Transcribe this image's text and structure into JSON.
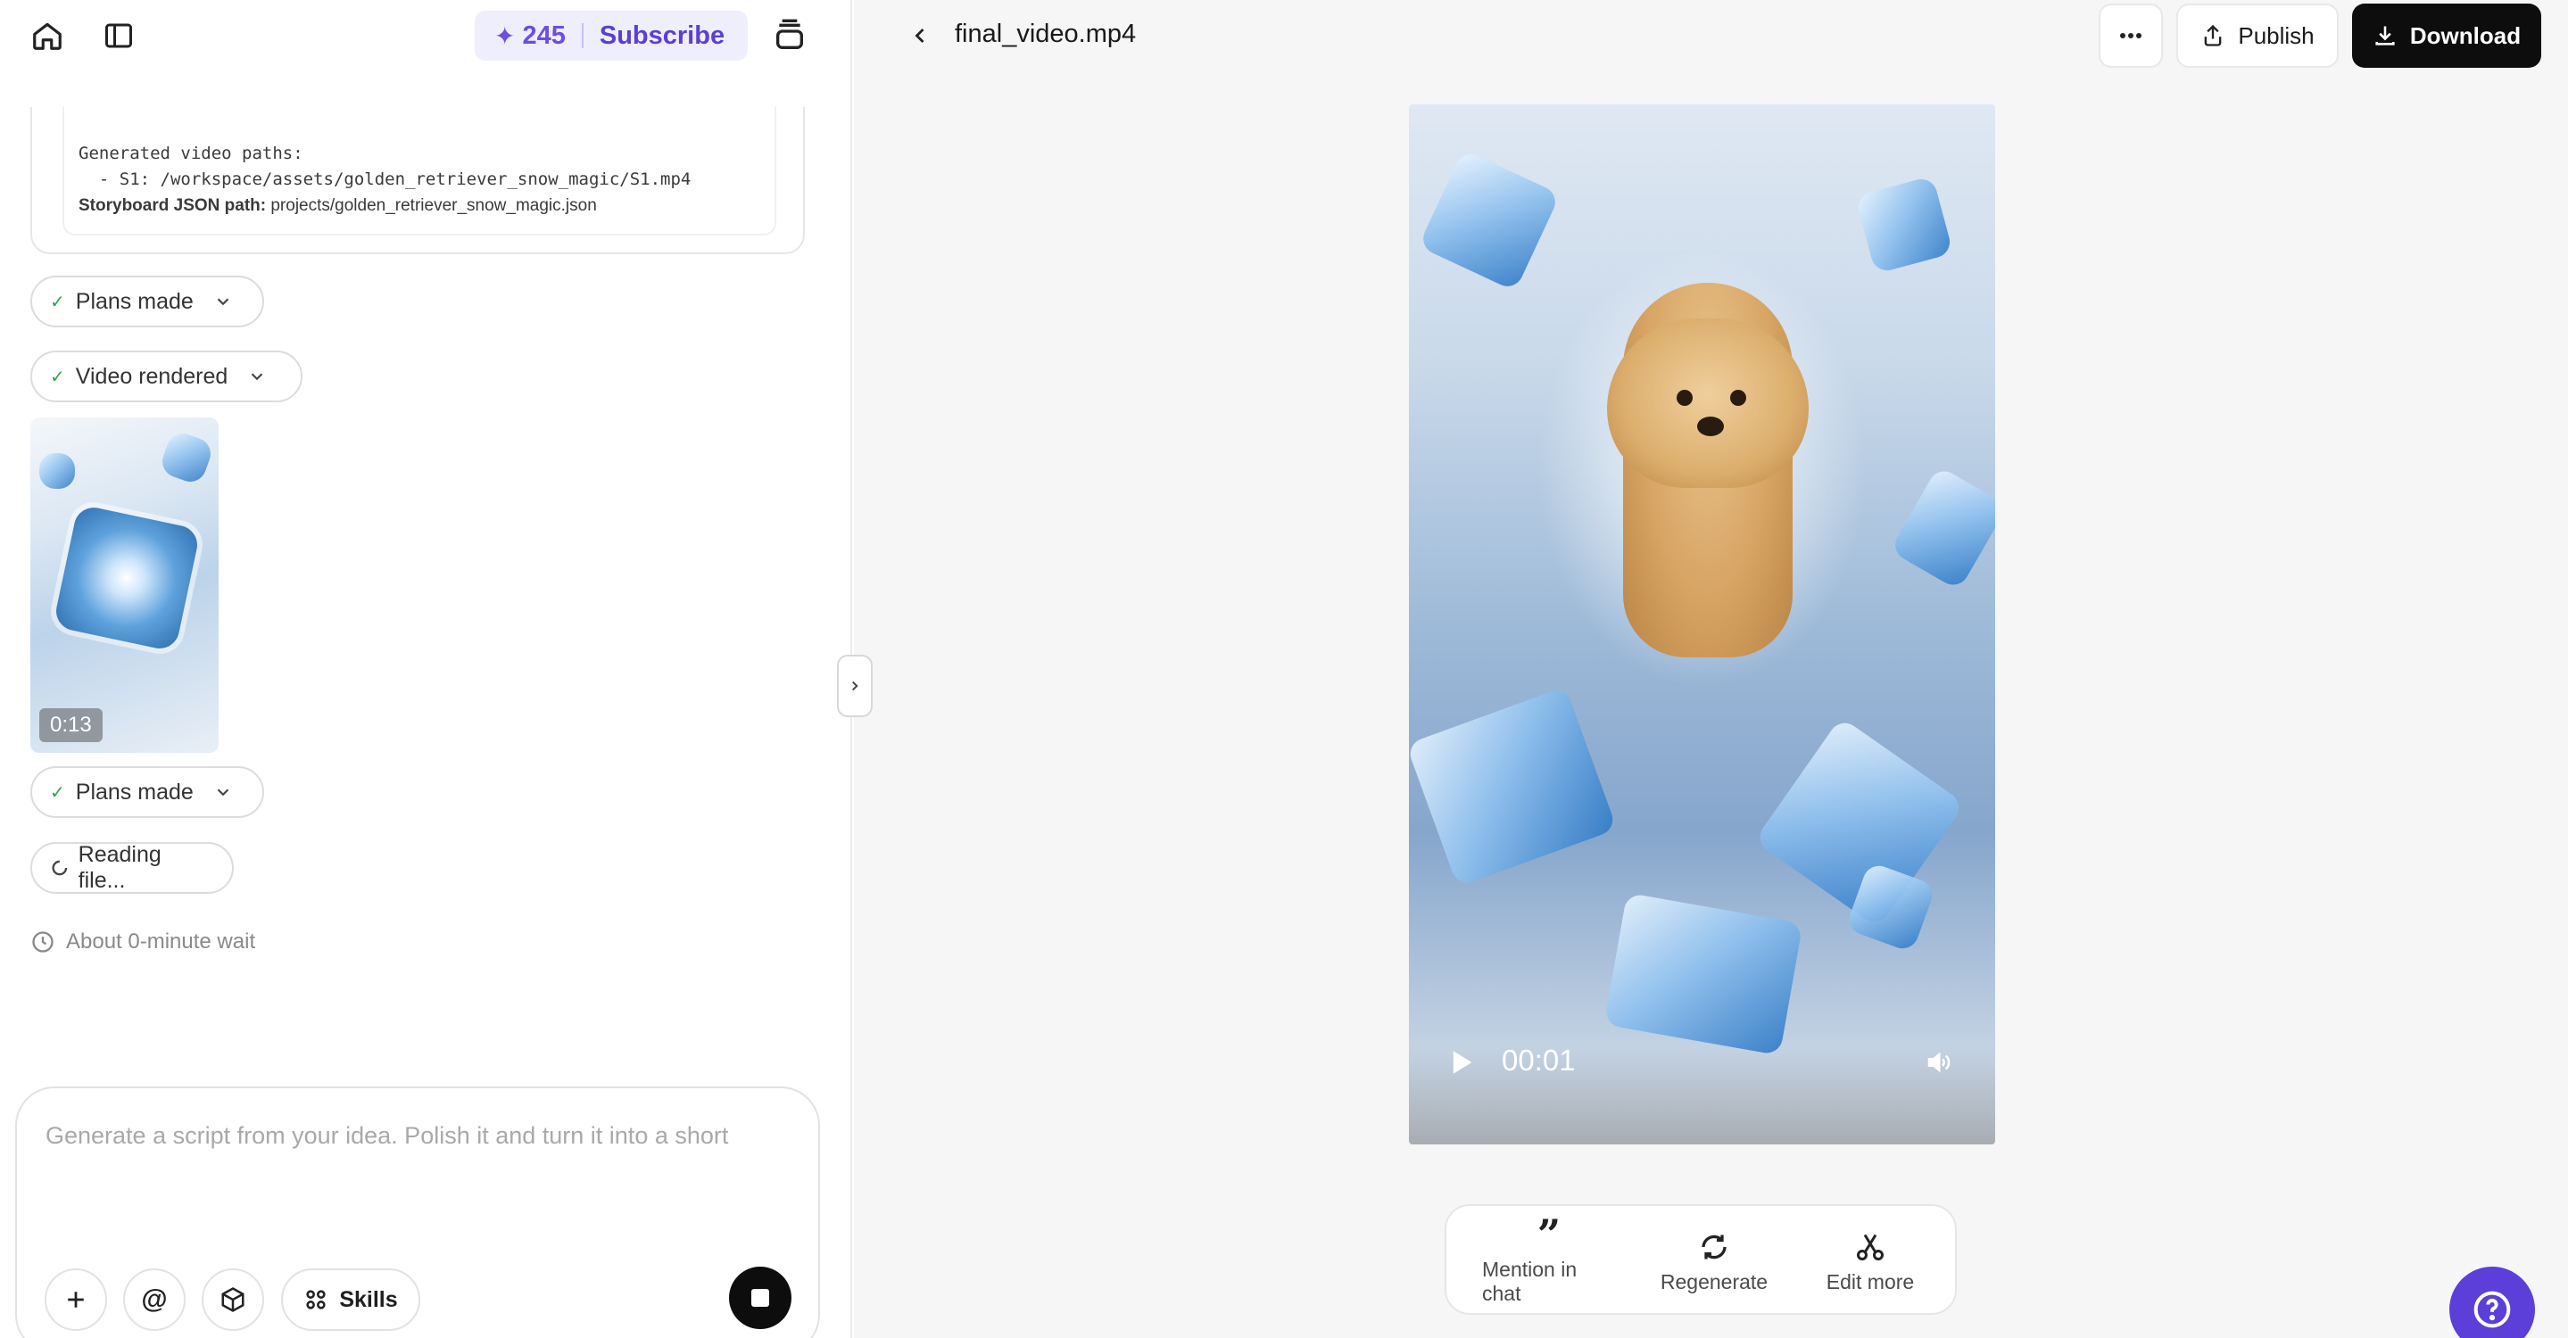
{
  "left_panel": {
    "credits": {
      "count": "245",
      "subscribe_label": "Subscribe"
    },
    "log": {
      "generated_paths_label": "Generated video paths:",
      "path_line": "  - S1: /workspace/assets/golden_retriever_snow_magic/S1.mp4",
      "storyboard_label": "Storyboard JSON path:",
      "storyboard_value": "projects/golden_retriever_snow_magic.json"
    },
    "steps": {
      "plans_made_1": "Plans made",
      "video_rendered": "Video rendered",
      "plans_made_2": "Plans made",
      "reading_file": "Reading file..."
    },
    "thumbnail": {
      "duration": "0:13"
    },
    "wait_text": "About 0-minute wait",
    "composer": {
      "placeholder": "Generate a script from your idea. Polish it and turn it into a short",
      "skills_label": "Skills"
    }
  },
  "right_panel": {
    "file_name": "final_video.mp4",
    "publish_label": "Publish",
    "download_label": "Download",
    "video": {
      "current_time": "00:01",
      "progress_fraction": 0.05
    },
    "actions": {
      "mention": "Mention in chat",
      "regenerate": "Regenerate",
      "edit_more": "Edit more"
    }
  },
  "colors": {
    "accent": "#6c4de6",
    "dark_button": "#0d0d0d",
    "help_button": "#5b3fd8",
    "success_check": "#2ea44f"
  },
  "icons": [
    "home-icon",
    "sidebar-toggle-icon",
    "sparkle-icon",
    "stack-icon",
    "check-icon",
    "chevron-down-icon",
    "spinner-icon",
    "clock-icon",
    "chevron-right-icon",
    "plus-icon",
    "at-icon",
    "cube-icon",
    "skills-icon",
    "stop-icon",
    "back-chevron-icon",
    "more-icon",
    "share-icon",
    "download-icon",
    "play-icon",
    "volume-icon",
    "quote-icon",
    "refresh-icon",
    "scissors-icon",
    "help-icon"
  ]
}
